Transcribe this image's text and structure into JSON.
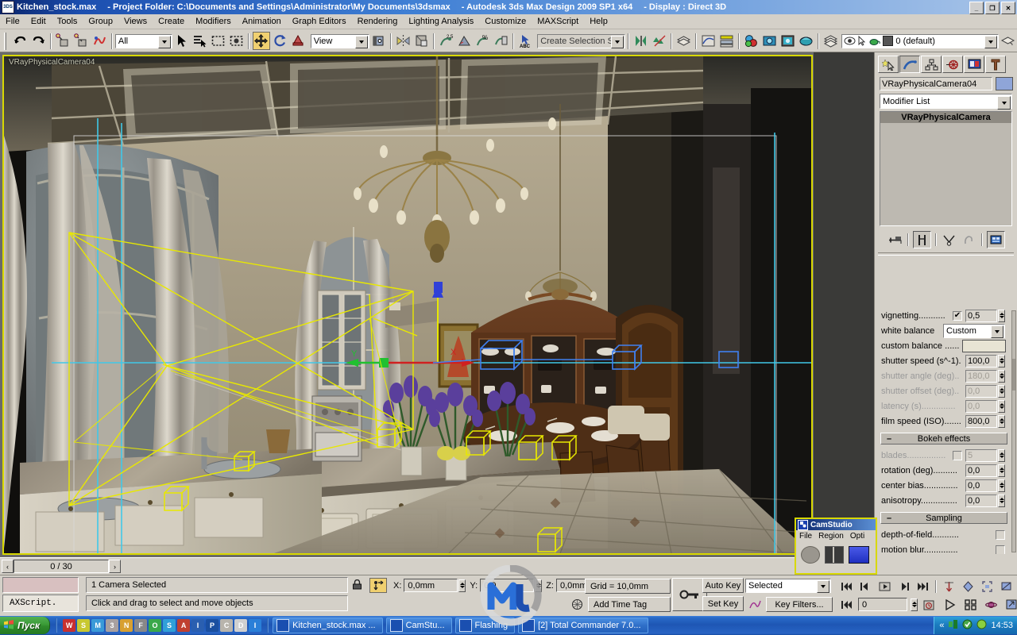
{
  "titlebar": {
    "icon": "3ds-max-icon",
    "filename": "Kitchen_stock.max",
    "project": "- Project Folder: C:\\Documents and Settings\\Administrator\\My Documents\\3dsmax",
    "product": "- Autodesk 3ds Max Design 2009 SP1  x64",
    "display": "- Display : Direct 3D",
    "minimize": "_",
    "restore": "❐",
    "close": "✕"
  },
  "menu": {
    "items": [
      "File",
      "Edit",
      "Tools",
      "Group",
      "Views",
      "Create",
      "Modifiers",
      "Animation",
      "Graph Editors",
      "Rendering",
      "Lighting Analysis",
      "Customize",
      "MAXScript",
      "Help"
    ]
  },
  "toolbar": {
    "undo_label": "undo-icon",
    "redo_label": "redo-icon",
    "select_filter_value": "All",
    "transform_ref_value": "View",
    "named_selection_placeholder": "Create Selection Set",
    "layer_value": "0 (default)",
    "buttons": [
      "undo-arrow",
      "redo-arrow",
      "select-link",
      "unlink",
      "bind-spacewarp",
      "select-object",
      "select-by-name",
      "select-region",
      "select-window-crossing",
      "select-and-move",
      "select-and-rotate",
      "select-and-scale",
      "mirror",
      "align",
      "layer-manager",
      "snap-toggle",
      "angle-snap",
      "percent-snap",
      "spinner-snap",
      "named-selection-sets",
      "mirror-selected",
      "array",
      "material-editor",
      "render-setup",
      "render-frame-window",
      "render-production",
      "schematic-view",
      "curve-editor",
      "quick-render"
    ]
  },
  "viewport": {
    "label": "VRayPhysicalCamera04",
    "scene_description": "classic kitchen interior 3D scene, chandelier, curtains, cabinetry, dining table with irises"
  },
  "command_panel": {
    "tabs": [
      "create-tab",
      "modify-tab",
      "hierarchy-tab",
      "motion-tab",
      "display-tab",
      "utilities-tab"
    ],
    "active_tab": "modify-tab",
    "object_name": "VRayPhysicalCamera04",
    "object_color": "#8fa5d8",
    "modifier_list_label": "Modifier List",
    "modifier_stack": [
      "VRayPhysicalCamera"
    ],
    "stack_buttons": [
      "pin-stack",
      "show-end-result",
      "make-unique",
      "remove-modifier",
      "configure-modifier-sets"
    ],
    "params": [
      {
        "label": "vignetting...........",
        "type": "check-spin",
        "checked": true,
        "value": "0,5",
        "disabled": false
      },
      {
        "label": "white balance",
        "type": "combo",
        "value": "Custom",
        "disabled": false
      },
      {
        "label": "custom balance ......",
        "type": "color",
        "value": "#e8e4d4",
        "disabled": false
      },
      {
        "label": "shutter speed (s^-1).",
        "type": "spin",
        "value": "100,0",
        "disabled": false
      },
      {
        "label": "shutter angle (deg)..",
        "type": "spin",
        "value": "180,0",
        "disabled": true
      },
      {
        "label": "shutter offset (deg)..",
        "type": "spin",
        "value": "0,0",
        "disabled": true
      },
      {
        "label": "latency (s)..............",
        "type": "spin",
        "value": "0,0",
        "disabled": true
      },
      {
        "label": "film speed (ISO).......",
        "type": "spin",
        "value": "800,0",
        "disabled": false
      }
    ],
    "bokeh": {
      "title": "Bokeh effects",
      "collapse": "–",
      "params": [
        {
          "label": "blades................",
          "type": "check-spin",
          "checked": false,
          "value": "5",
          "disabled": true
        },
        {
          "label": "rotation (deg)..........",
          "type": "spin",
          "value": "0,0",
          "disabled": false
        },
        {
          "label": "center bias..............",
          "type": "spin",
          "value": "0,0",
          "disabled": false
        },
        {
          "label": "anisotropy...............",
          "type": "spin",
          "value": "0,0",
          "disabled": false
        }
      ]
    },
    "sampling": {
      "title": "Sampling",
      "collapse": "–",
      "params": [
        {
          "label": "depth-of-field...........",
          "type": "check",
          "checked": false,
          "disabled": false
        },
        {
          "label": "motion blur..............",
          "type": "check",
          "checked": false,
          "disabled": false
        }
      ]
    }
  },
  "timebar": {
    "prev_label": "‹",
    "next_label": "›",
    "frame_counter": "0 / 30"
  },
  "status": {
    "maxscript_mini_listener": "",
    "maxscript_label": "AXScript.",
    "selection_info": "1 Camera Selected",
    "prompt": "Click and drag to select and move objects",
    "lock_icon": "lock-selection-icon",
    "absolute_mode_icon": "absolute-relative-transform-icon",
    "coords": [
      {
        "axis": "X:",
        "value": "0,0mm"
      },
      {
        "axis": "Y:",
        "value": "0,0"
      },
      {
        "axis": "Z:",
        "value": "0,0mm"
      }
    ],
    "grid": "Grid = 10,0mm",
    "add_time_tag": "Add Time Tag",
    "time_tag_icon": "time-tag-icon",
    "key_mode_icon": "key-mode-toggle-icon",
    "auto_key": "Auto Key",
    "set_key": "Set Key",
    "key_filters": "Key Filters...",
    "selected_filter": "Selected",
    "param_curve_icon": "param-curve-icon",
    "current_frame": "0",
    "playback_icons": [
      "goto-start",
      "previous-frame",
      "play-animation",
      "next-frame",
      "goto-end"
    ],
    "time_config_icon": "time-configuration-icon",
    "nav_icons": [
      "zoom",
      "zoom-all",
      "zoom-extents",
      "field-of-view",
      "pan-view",
      "arc-rotate",
      "maximize-viewport-toggle"
    ]
  },
  "camstudio": {
    "title": "CamStudio",
    "icon": "camstudio-icon",
    "menu": [
      "File",
      "Region",
      "Opti"
    ],
    "buttons": [
      "record-button",
      "pause-button",
      "stop-button"
    ]
  },
  "taskbar": {
    "start_label": "Пуск",
    "start_icon": "windows-flag-icon",
    "quick_launch": [
      "winamp-icon",
      "save-icon",
      "media-icon",
      "3dsmax-icon",
      "notepad-icon",
      "film-icon",
      "opera-icon",
      "sync-icon",
      "acrobat-icon",
      "irfan-icon",
      "photoshop-icon",
      "calc-icon",
      "doc-icon",
      "ie-icon"
    ],
    "tasks": [
      {
        "icon": "3dsmax-icon",
        "label": "Kitchen_stock.max",
        "ellipsis": "..."
      },
      {
        "icon": "camstudio-icon",
        "label": "CamStu..."
      },
      {
        "icon": "flashing-icon",
        "label": "Flashing"
      },
      {
        "icon": "total-commander-icon",
        "label": "[2] Total Commander 7.0..."
      }
    ],
    "tray_chevron": "«",
    "tray_icons": [
      "network-icon",
      "shield-icon",
      "green-icon"
    ],
    "clock": "14:53"
  },
  "colors": {
    "accent_yellow": "#d8d800",
    "panel": "#d4d0c8",
    "title_blue": "#0a246a",
    "taskbar_blue": "#225fba",
    "active_btn": "#f0d070"
  }
}
